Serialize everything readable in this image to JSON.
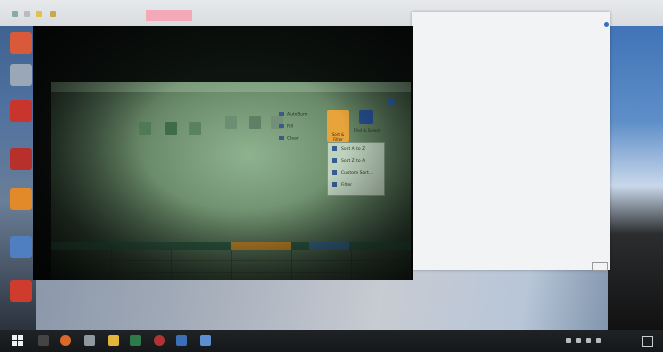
{
  "background_window": {
    "pink_tab_label": "",
    "sheet_title": "",
    "sheet_header": "",
    "rows": [
      {
        "label": "",
        "value": ""
      },
      {
        "label": "",
        "value": ""
      },
      {
        "label": "",
        "value": ""
      },
      {
        "label": "",
        "value": ""
      }
    ],
    "total_label": ""
  },
  "excel": {
    "title": "",
    "ribbon": {
      "editing_items": [
        "AutoSum",
        "Fill",
        "Clear"
      ],
      "sort_filter_label": "Sort & Filter",
      "find_select_label": "Find & Select"
    },
    "sort_menu": {
      "items": [
        "Sort A to Z",
        "Sort Z to A",
        "Custom Sort...",
        "Filter"
      ]
    }
  },
  "taskbar": {
    "time": "",
    "date": ""
  },
  "colors": {
    "accent_orange": "#e8a33b",
    "accent_blue": "#264e91",
    "taskbar": "#1a1d20"
  },
  "icons": [
    "windows-start-icon",
    "search-icon",
    "file-explorer-icon",
    "chrome-icon",
    "excel-icon",
    "mail-icon"
  ]
}
